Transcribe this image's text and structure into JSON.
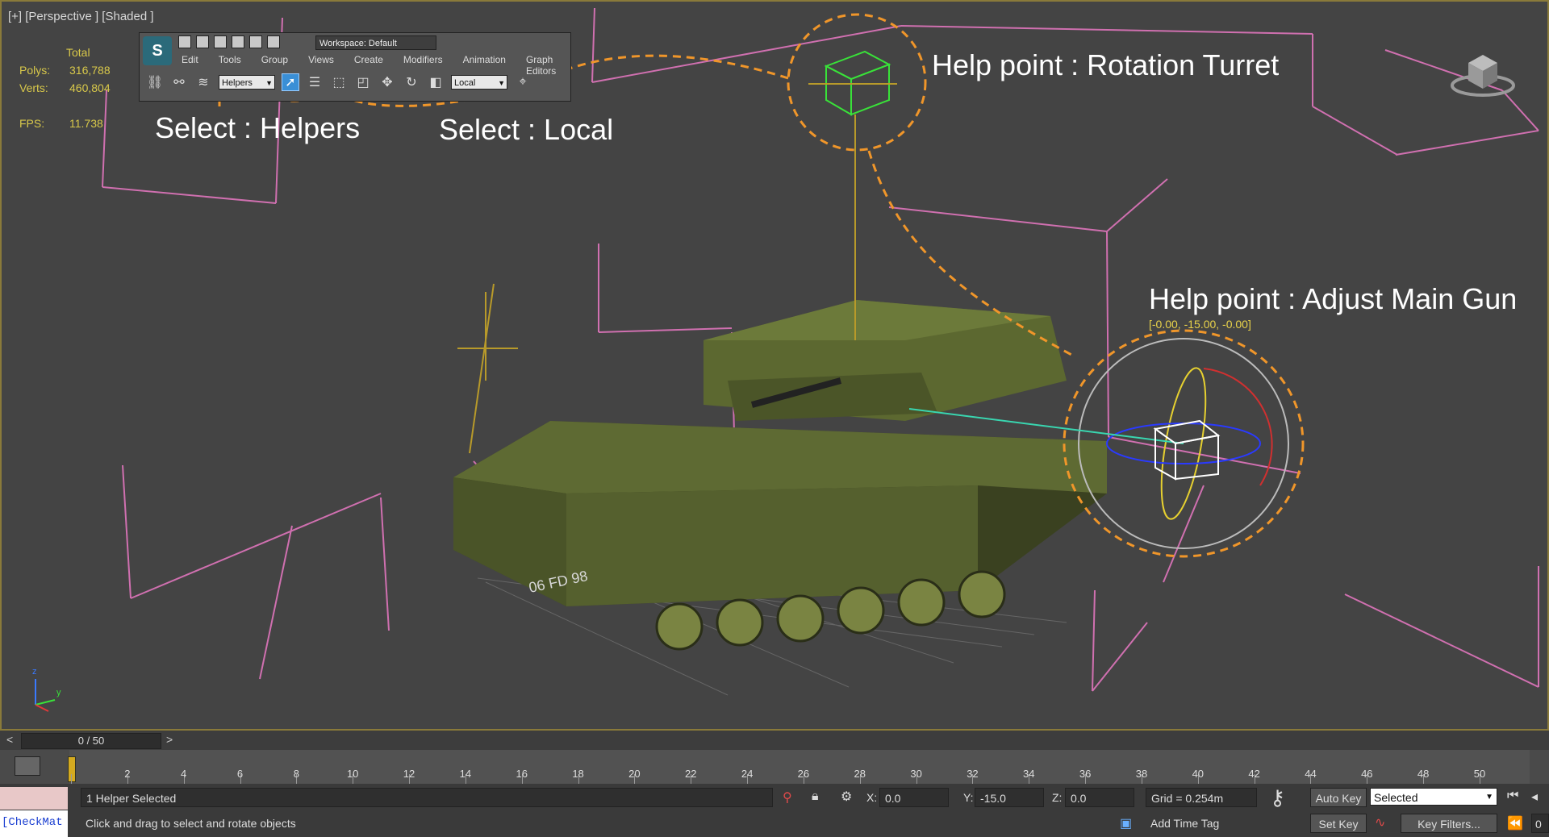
{
  "viewport": {
    "label": "[+] [Perspective ] [Shaded ]",
    "stats": {
      "header": "Total",
      "polys_label": "Polys:",
      "polys_value": "316,788",
      "verts_label": "Verts:",
      "verts_value": "460,804",
      "fps_label": "FPS:",
      "fps_value": "11.738"
    },
    "annotations": {
      "select_helpers": "Select : Helpers",
      "select_local": "Select : Local",
      "help_turret": "Help point : Rotation Turret",
      "help_main_gun": "Help point : Adjust Main Gun",
      "gizmo_coords": "[-0.00, -15.00, -0.00]",
      "plate": "06 FD 98"
    },
    "axis": {
      "z": "z",
      "y": "y"
    }
  },
  "toolbar": {
    "logo": "S",
    "workspace": "Workspace: Default",
    "menu": [
      "Edit",
      "Tools",
      "Group",
      "Views",
      "Create",
      "Modifiers",
      "Animation",
      "Graph Editors"
    ],
    "selection_filter": "Helpers",
    "coord_system": "Local",
    "icons": [
      "link-icon",
      "unlink-icon",
      "bind-space-warp-icon",
      "select-object-icon",
      "select-by-name-icon",
      "rect-region-icon",
      "window-crossing-icon",
      "move-icon",
      "rotate-icon",
      "use-pivot-icon",
      "select-manipulate-icon"
    ]
  },
  "timeline": {
    "frame_display": "0 / 50",
    "prev": "<",
    "next": ">",
    "ticks": [
      "0",
      "2",
      "4",
      "6",
      "8",
      "10",
      "12",
      "14",
      "16",
      "18",
      "20",
      "22",
      "24",
      "26",
      "28",
      "30",
      "32",
      "34",
      "36",
      "38",
      "40",
      "42",
      "44",
      "46",
      "48",
      "50"
    ]
  },
  "status": {
    "selection": "1 Helper Selected",
    "prompt": "Click and drag to select and rotate objects",
    "x_label": "X:",
    "x_value": "0.0",
    "y_label": "Y:",
    "y_value": "-15.0",
    "z_label": "Z:",
    "z_value": "0.0",
    "grid": "Grid = 0.254m",
    "add_time_tag": "Add Time Tag",
    "auto_key": "Auto Key",
    "set_key": "Set Key",
    "key_mode_selected": "Selected",
    "key_filters": "Key Filters...",
    "listener": "[CheckMat",
    "frame_field": "0"
  },
  "colors": {
    "viewport_bg": "#444444",
    "annotation_orange": "#f0962a",
    "stats_yellow": "#d8c84a",
    "grid_pink": "#d070b0"
  }
}
